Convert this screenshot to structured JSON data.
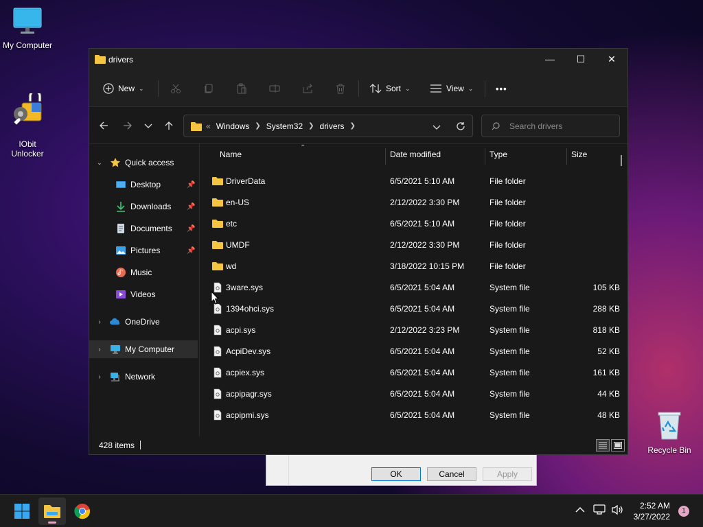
{
  "desktop": {
    "icons": [
      {
        "label": "My Computer"
      },
      {
        "label": "IObit\nUnlocker"
      },
      {
        "label": "Recycle Bin"
      }
    ]
  },
  "background_dialog": {
    "ok_label": "OK",
    "cancel_label": "Cancel",
    "apply_label": "Apply"
  },
  "window": {
    "title": "drivers",
    "controls": {
      "minimize": "—",
      "maximize": "☐",
      "close": "✕"
    }
  },
  "commandbar": {
    "new_label": "New",
    "sort_label": "Sort",
    "view_label": "View",
    "more_label": "•••"
  },
  "address": {
    "overflow": "«",
    "crumbs": [
      "Windows",
      "System32",
      "drivers"
    ],
    "search_placeholder": "Search drivers"
  },
  "navpane": {
    "quick_access": "Quick access",
    "items": [
      {
        "label": "Desktop",
        "pinned": true
      },
      {
        "label": "Downloads",
        "pinned": true
      },
      {
        "label": "Documents",
        "pinned": true
      },
      {
        "label": "Pictures",
        "pinned": true
      },
      {
        "label": "Music",
        "pinned": false
      },
      {
        "label": "Videos",
        "pinned": false
      }
    ],
    "onedrive": "OneDrive",
    "mycomputer": "My Computer",
    "network": "Network"
  },
  "columns": {
    "name": "Name",
    "date": "Date modified",
    "type": "Type",
    "size": "Size"
  },
  "files": [
    {
      "name": "DriverData",
      "date": "6/5/2021 5:10 AM",
      "type": "File folder",
      "size": "",
      "kind": "folder"
    },
    {
      "name": "en-US",
      "date": "2/12/2022 3:30 PM",
      "type": "File folder",
      "size": "",
      "kind": "folder"
    },
    {
      "name": "etc",
      "date": "6/5/2021 5:10 AM",
      "type": "File folder",
      "size": "",
      "kind": "folder"
    },
    {
      "name": "UMDF",
      "date": "2/12/2022 3:30 PM",
      "type": "File folder",
      "size": "",
      "kind": "folder"
    },
    {
      "name": "wd",
      "date": "3/18/2022 10:15 PM",
      "type": "File folder",
      "size": "",
      "kind": "folder"
    },
    {
      "name": "3ware.sys",
      "date": "6/5/2021 5:04 AM",
      "type": "System file",
      "size": "105 KB",
      "kind": "file"
    },
    {
      "name": "1394ohci.sys",
      "date": "6/5/2021 5:04 AM",
      "type": "System file",
      "size": "288 KB",
      "kind": "file"
    },
    {
      "name": "acpi.sys",
      "date": "2/12/2022 3:23 PM",
      "type": "System file",
      "size": "818 KB",
      "kind": "file"
    },
    {
      "name": "AcpiDev.sys",
      "date": "6/5/2021 5:04 AM",
      "type": "System file",
      "size": "52 KB",
      "kind": "file"
    },
    {
      "name": "acpiex.sys",
      "date": "6/5/2021 5:04 AM",
      "type": "System file",
      "size": "161 KB",
      "kind": "file"
    },
    {
      "name": "acpipagr.sys",
      "date": "6/5/2021 5:04 AM",
      "type": "System file",
      "size": "44 KB",
      "kind": "file"
    },
    {
      "name": "acpipmi.sys",
      "date": "6/5/2021 5:04 AM",
      "type": "System file",
      "size": "48 KB",
      "kind": "file"
    }
  ],
  "statusbar": {
    "item_count": "428 items"
  },
  "taskbar": {
    "time": "2:52 AM",
    "date": "3/27/2022",
    "notification_count": "1"
  },
  "colors": {
    "accent": "#0078d4",
    "folder": "#f4c542",
    "window_bg": "#191919",
    "taskbar_bg": "#1c1c1c"
  }
}
